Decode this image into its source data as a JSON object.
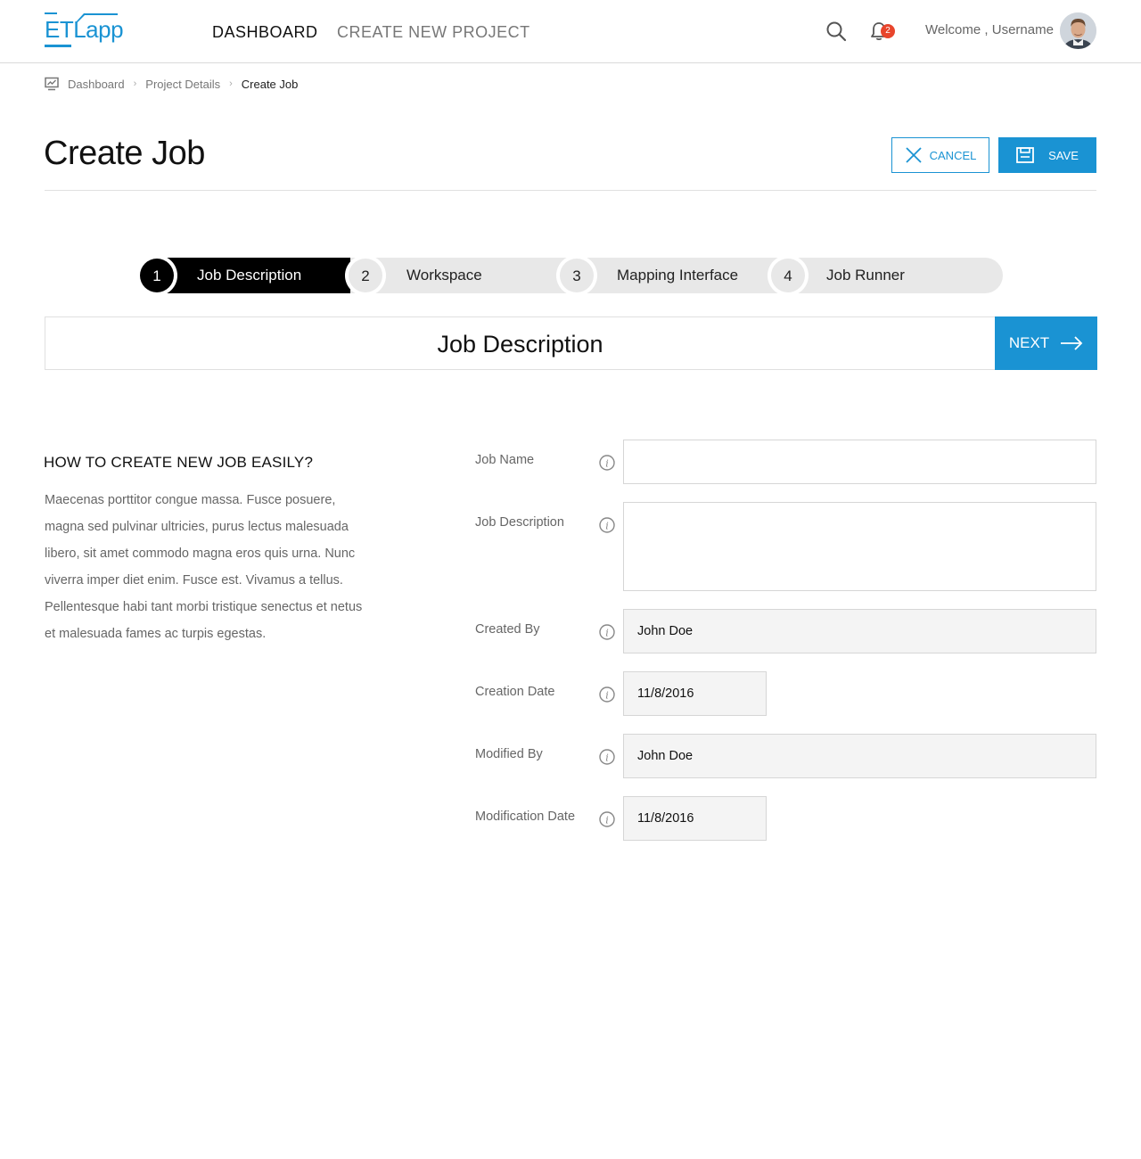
{
  "header": {
    "logo_text": "ETLapp",
    "nav": {
      "dashboard": "DASHBOARD",
      "create_project": "CREATE NEW PROJECT"
    },
    "notifications_count": "2",
    "welcome": "Welcome , Username"
  },
  "breadcrumb": {
    "items": [
      "Dashboard",
      "Project Details",
      "Create Job"
    ]
  },
  "page": {
    "title": "Create Job",
    "cancel_label": "CANCEL",
    "save_label": "SAVE"
  },
  "stepper": {
    "steps": [
      {
        "number": "1",
        "label": "Job Description",
        "active": true
      },
      {
        "number": "2",
        "label": "Workspace",
        "active": false
      },
      {
        "number": "3",
        "label": "Mapping Interface",
        "active": false
      },
      {
        "number": "4",
        "label": "Job Runner",
        "active": false
      }
    ]
  },
  "section": {
    "title": "Job Description",
    "next_label": "NEXT"
  },
  "help": {
    "title": "HOW TO CREATE NEW JOB EASILY?",
    "body": "Maecenas porttitor congue massa. Fusce posuere, magna sed pulvinar ultricies, purus lectus malesuada libero, sit amet commodo magna eros quis urna. Nunc viverra imper diet enim. Fusce est. Vivamus a tellus. Pellentesque habi tant morbi tristique senectus et netus et malesuada fames ac turpis egestas."
  },
  "form": {
    "job_name": {
      "label": "Job Name",
      "value": ""
    },
    "job_description": {
      "label": "Job Description",
      "value": ""
    },
    "created_by": {
      "label": "Created By",
      "value": "John Doe"
    },
    "creation_date": {
      "label": "Creation Date",
      "value": "11/8/2016"
    },
    "modified_by": {
      "label": "Modified By",
      "value": "John Doe"
    },
    "modification_date": {
      "label": "Modification Date",
      "value": "11/8/2016"
    }
  },
  "colors": {
    "accent": "#1a93d3",
    "badge": "#e8452c",
    "active_step": "#000000"
  }
}
